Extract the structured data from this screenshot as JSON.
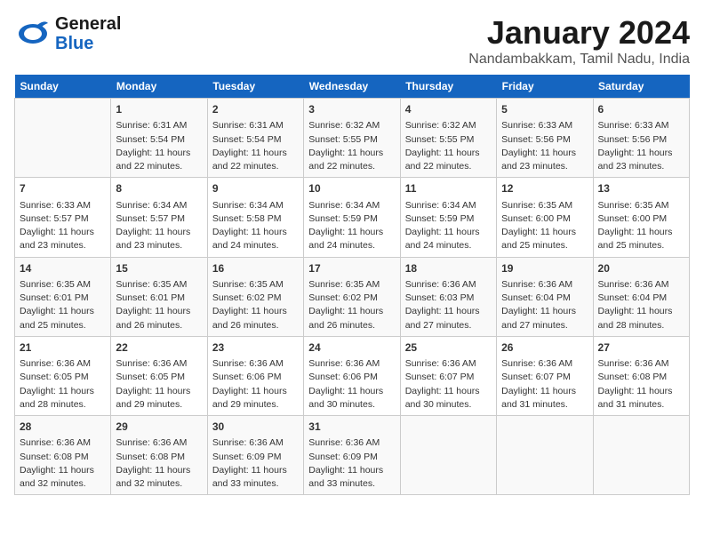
{
  "logo": {
    "line1": "General",
    "line2": "Blue"
  },
  "header": {
    "month": "January 2024",
    "location": "Nandambakkam, Tamil Nadu, India"
  },
  "days_of_week": [
    "Sunday",
    "Monday",
    "Tuesday",
    "Wednesday",
    "Thursday",
    "Friday",
    "Saturday"
  ],
  "weeks": [
    [
      {
        "day": "",
        "info": ""
      },
      {
        "day": "1",
        "info": "Sunrise: 6:31 AM\nSunset: 5:54 PM\nDaylight: 11 hours\nand 22 minutes."
      },
      {
        "day": "2",
        "info": "Sunrise: 6:31 AM\nSunset: 5:54 PM\nDaylight: 11 hours\nand 22 minutes."
      },
      {
        "day": "3",
        "info": "Sunrise: 6:32 AM\nSunset: 5:55 PM\nDaylight: 11 hours\nand 22 minutes."
      },
      {
        "day": "4",
        "info": "Sunrise: 6:32 AM\nSunset: 5:55 PM\nDaylight: 11 hours\nand 22 minutes."
      },
      {
        "day": "5",
        "info": "Sunrise: 6:33 AM\nSunset: 5:56 PM\nDaylight: 11 hours\nand 23 minutes."
      },
      {
        "day": "6",
        "info": "Sunrise: 6:33 AM\nSunset: 5:56 PM\nDaylight: 11 hours\nand 23 minutes."
      }
    ],
    [
      {
        "day": "7",
        "info": "Sunrise: 6:33 AM\nSunset: 5:57 PM\nDaylight: 11 hours\nand 23 minutes."
      },
      {
        "day": "8",
        "info": "Sunrise: 6:34 AM\nSunset: 5:57 PM\nDaylight: 11 hours\nand 23 minutes."
      },
      {
        "day": "9",
        "info": "Sunrise: 6:34 AM\nSunset: 5:58 PM\nDaylight: 11 hours\nand 24 minutes."
      },
      {
        "day": "10",
        "info": "Sunrise: 6:34 AM\nSunset: 5:59 PM\nDaylight: 11 hours\nand 24 minutes."
      },
      {
        "day": "11",
        "info": "Sunrise: 6:34 AM\nSunset: 5:59 PM\nDaylight: 11 hours\nand 24 minutes."
      },
      {
        "day": "12",
        "info": "Sunrise: 6:35 AM\nSunset: 6:00 PM\nDaylight: 11 hours\nand 25 minutes."
      },
      {
        "day": "13",
        "info": "Sunrise: 6:35 AM\nSunset: 6:00 PM\nDaylight: 11 hours\nand 25 minutes."
      }
    ],
    [
      {
        "day": "14",
        "info": "Sunrise: 6:35 AM\nSunset: 6:01 PM\nDaylight: 11 hours\nand 25 minutes."
      },
      {
        "day": "15",
        "info": "Sunrise: 6:35 AM\nSunset: 6:01 PM\nDaylight: 11 hours\nand 26 minutes."
      },
      {
        "day": "16",
        "info": "Sunrise: 6:35 AM\nSunset: 6:02 PM\nDaylight: 11 hours\nand 26 minutes."
      },
      {
        "day": "17",
        "info": "Sunrise: 6:35 AM\nSunset: 6:02 PM\nDaylight: 11 hours\nand 26 minutes."
      },
      {
        "day": "18",
        "info": "Sunrise: 6:36 AM\nSunset: 6:03 PM\nDaylight: 11 hours\nand 27 minutes."
      },
      {
        "day": "19",
        "info": "Sunrise: 6:36 AM\nSunset: 6:04 PM\nDaylight: 11 hours\nand 27 minutes."
      },
      {
        "day": "20",
        "info": "Sunrise: 6:36 AM\nSunset: 6:04 PM\nDaylight: 11 hours\nand 28 minutes."
      }
    ],
    [
      {
        "day": "21",
        "info": "Sunrise: 6:36 AM\nSunset: 6:05 PM\nDaylight: 11 hours\nand 28 minutes."
      },
      {
        "day": "22",
        "info": "Sunrise: 6:36 AM\nSunset: 6:05 PM\nDaylight: 11 hours\nand 29 minutes."
      },
      {
        "day": "23",
        "info": "Sunrise: 6:36 AM\nSunset: 6:06 PM\nDaylight: 11 hours\nand 29 minutes."
      },
      {
        "day": "24",
        "info": "Sunrise: 6:36 AM\nSunset: 6:06 PM\nDaylight: 11 hours\nand 30 minutes."
      },
      {
        "day": "25",
        "info": "Sunrise: 6:36 AM\nSunset: 6:07 PM\nDaylight: 11 hours\nand 30 minutes."
      },
      {
        "day": "26",
        "info": "Sunrise: 6:36 AM\nSunset: 6:07 PM\nDaylight: 11 hours\nand 31 minutes."
      },
      {
        "day": "27",
        "info": "Sunrise: 6:36 AM\nSunset: 6:08 PM\nDaylight: 11 hours\nand 31 minutes."
      }
    ],
    [
      {
        "day": "28",
        "info": "Sunrise: 6:36 AM\nSunset: 6:08 PM\nDaylight: 11 hours\nand 32 minutes."
      },
      {
        "day": "29",
        "info": "Sunrise: 6:36 AM\nSunset: 6:08 PM\nDaylight: 11 hours\nand 32 minutes."
      },
      {
        "day": "30",
        "info": "Sunrise: 6:36 AM\nSunset: 6:09 PM\nDaylight: 11 hours\nand 33 minutes."
      },
      {
        "day": "31",
        "info": "Sunrise: 6:36 AM\nSunset: 6:09 PM\nDaylight: 11 hours\nand 33 minutes."
      },
      {
        "day": "",
        "info": ""
      },
      {
        "day": "",
        "info": ""
      },
      {
        "day": "",
        "info": ""
      }
    ]
  ]
}
